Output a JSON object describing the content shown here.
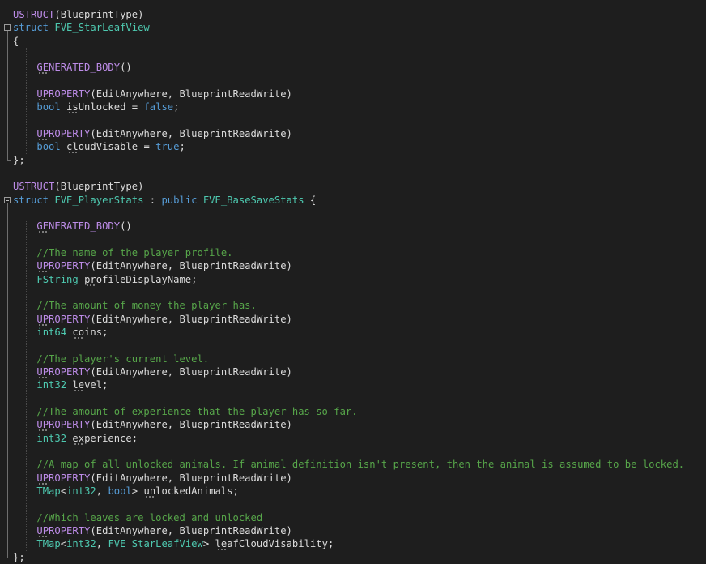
{
  "colors": {
    "background": "#1e1e1e",
    "default": "#dcdcdc",
    "keyword": "#569cd6",
    "macro": "#bd8ce8",
    "type": "#4ec9b0",
    "comment": "#57a64a",
    "variable": "#dcdcdc"
  },
  "lines": [
    {
      "tokens": [
        {
          "t": "USTRUCT",
          "c": "macro"
        },
        {
          "t": "(BlueprintType)",
          "c": "default"
        }
      ]
    },
    {
      "fold": true,
      "tokens": [
        {
          "t": "struct ",
          "c": "keyword"
        },
        {
          "t": "FVE_StarLeafView",
          "c": "type"
        }
      ]
    },
    {
      "tokens": [
        {
          "t": "{",
          "c": "default"
        }
      ]
    },
    {
      "tokens": []
    },
    {
      "tokens": [
        {
          "t": "    ",
          "c": "default"
        },
        {
          "t": "GENERATED_BODY",
          "c": "macro"
        },
        {
          "t": "()",
          "c": "default"
        }
      ]
    },
    {
      "tokens": []
    },
    {
      "tokens": [
        {
          "t": "    ",
          "c": "default"
        },
        {
          "t": "UPROPERTY",
          "c": "macro"
        },
        {
          "t": "(EditAnywhere, BlueprintReadWrite)",
          "c": "default"
        }
      ]
    },
    {
      "tokens": [
        {
          "t": "    ",
          "c": "default"
        },
        {
          "t": "bool ",
          "c": "keyword"
        },
        {
          "t": "isUnlocked",
          "c": "variable"
        },
        {
          "t": " = ",
          "c": "default"
        },
        {
          "t": "false",
          "c": "keyword"
        },
        {
          "t": ";",
          "c": "default"
        }
      ]
    },
    {
      "tokens": []
    },
    {
      "tokens": [
        {
          "t": "    ",
          "c": "default"
        },
        {
          "t": "UPROPERTY",
          "c": "macro"
        },
        {
          "t": "(EditAnywhere, BlueprintReadWrite)",
          "c": "default"
        }
      ]
    },
    {
      "tokens": [
        {
          "t": "    ",
          "c": "default"
        },
        {
          "t": "bool ",
          "c": "keyword"
        },
        {
          "t": "cloudVisable",
          "c": "variable"
        },
        {
          "t": " = ",
          "c": "default"
        },
        {
          "t": "true",
          "c": "keyword"
        },
        {
          "t": ";",
          "c": "default"
        }
      ]
    },
    {
      "tokens": [
        {
          "t": "};",
          "c": "default"
        }
      ]
    },
    {
      "tokens": []
    },
    {
      "tokens": [
        {
          "t": "USTRUCT",
          "c": "macro"
        },
        {
          "t": "(BlueprintType)",
          "c": "default"
        }
      ]
    },
    {
      "fold": true,
      "tokens": [
        {
          "t": "struct ",
          "c": "keyword"
        },
        {
          "t": "FVE_PlayerStats",
          "c": "type"
        },
        {
          "t": " : ",
          "c": "default"
        },
        {
          "t": "public ",
          "c": "keyword"
        },
        {
          "t": "FVE_BaseSaveStats",
          "c": "type"
        },
        {
          "t": " {",
          "c": "default"
        }
      ]
    },
    {
      "tokens": []
    },
    {
      "tokens": [
        {
          "t": "    ",
          "c": "default"
        },
        {
          "t": "GENERATED_BODY",
          "c": "macro"
        },
        {
          "t": "()",
          "c": "default"
        }
      ]
    },
    {
      "tokens": []
    },
    {
      "tokens": [
        {
          "t": "    ",
          "c": "default"
        },
        {
          "t": "//The name of the player profile.",
          "c": "comment"
        }
      ]
    },
    {
      "tokens": [
        {
          "t": "    ",
          "c": "default"
        },
        {
          "t": "UPROPERTY",
          "c": "macro"
        },
        {
          "t": "(EditAnywhere, BlueprintReadWrite)",
          "c": "default"
        }
      ]
    },
    {
      "tokens": [
        {
          "t": "    ",
          "c": "default"
        },
        {
          "t": "FString ",
          "c": "type"
        },
        {
          "t": "profileDisplayName",
          "c": "variable"
        },
        {
          "t": ";",
          "c": "default"
        }
      ]
    },
    {
      "tokens": []
    },
    {
      "tokens": [
        {
          "t": "    ",
          "c": "default"
        },
        {
          "t": "//The amount of money the player has.",
          "c": "comment"
        }
      ]
    },
    {
      "tokens": [
        {
          "t": "    ",
          "c": "default"
        },
        {
          "t": "UPROPERTY",
          "c": "macro"
        },
        {
          "t": "(EditAnywhere, BlueprintReadWrite)",
          "c": "default"
        }
      ]
    },
    {
      "tokens": [
        {
          "t": "    ",
          "c": "default"
        },
        {
          "t": "int64 ",
          "c": "type"
        },
        {
          "t": "coins",
          "c": "variable"
        },
        {
          "t": ";",
          "c": "default"
        }
      ]
    },
    {
      "tokens": []
    },
    {
      "tokens": [
        {
          "t": "    ",
          "c": "default"
        },
        {
          "t": "//The player's current level.",
          "c": "comment"
        }
      ]
    },
    {
      "tokens": [
        {
          "t": "    ",
          "c": "default"
        },
        {
          "t": "UPROPERTY",
          "c": "macro"
        },
        {
          "t": "(EditAnywhere, BlueprintReadWrite)",
          "c": "default"
        }
      ]
    },
    {
      "tokens": [
        {
          "t": "    ",
          "c": "default"
        },
        {
          "t": "int32 ",
          "c": "type"
        },
        {
          "t": "level",
          "c": "variable"
        },
        {
          "t": ";",
          "c": "default"
        }
      ]
    },
    {
      "tokens": []
    },
    {
      "tokens": [
        {
          "t": "    ",
          "c": "default"
        },
        {
          "t": "//The amount of experience that the player has so far.",
          "c": "comment"
        }
      ]
    },
    {
      "tokens": [
        {
          "t": "    ",
          "c": "default"
        },
        {
          "t": "UPROPERTY",
          "c": "macro"
        },
        {
          "t": "(EditAnywhere, BlueprintReadWrite)",
          "c": "default"
        }
      ]
    },
    {
      "tokens": [
        {
          "t": "    ",
          "c": "default"
        },
        {
          "t": "int32 ",
          "c": "type"
        },
        {
          "t": "experience",
          "c": "variable"
        },
        {
          "t": ";",
          "c": "default"
        }
      ]
    },
    {
      "tokens": []
    },
    {
      "tokens": [
        {
          "t": "    ",
          "c": "default"
        },
        {
          "t": "//A map of all unlocked animals. If animal definition isn't present, then the animal is assumed to be locked.",
          "c": "comment"
        }
      ]
    },
    {
      "tokens": [
        {
          "t": "    ",
          "c": "default"
        },
        {
          "t": "UPROPERTY",
          "c": "macro"
        },
        {
          "t": "(EditAnywhere, BlueprintReadWrite)",
          "c": "default"
        }
      ]
    },
    {
      "tokens": [
        {
          "t": "    ",
          "c": "default"
        },
        {
          "t": "TMap",
          "c": "type"
        },
        {
          "t": "<",
          "c": "default"
        },
        {
          "t": "int32",
          "c": "type"
        },
        {
          "t": ", ",
          "c": "default"
        },
        {
          "t": "bool",
          "c": "keyword"
        },
        {
          "t": "> ",
          "c": "default"
        },
        {
          "t": "unlockedAnimals",
          "c": "variable"
        },
        {
          "t": ";",
          "c": "default"
        }
      ]
    },
    {
      "tokens": []
    },
    {
      "tokens": [
        {
          "t": "    ",
          "c": "default"
        },
        {
          "t": "//Which leaves are locked and unlocked",
          "c": "comment"
        }
      ]
    },
    {
      "tokens": [
        {
          "t": "    ",
          "c": "default"
        },
        {
          "t": "UPROPERTY",
          "c": "macro"
        },
        {
          "t": "(EditAnywhere, BlueprintReadWrite)",
          "c": "default"
        }
      ]
    },
    {
      "tokens": [
        {
          "t": "    ",
          "c": "default"
        },
        {
          "t": "TMap",
          "c": "type"
        },
        {
          "t": "<",
          "c": "default"
        },
        {
          "t": "int32",
          "c": "type"
        },
        {
          "t": ", ",
          "c": "default"
        },
        {
          "t": "FVE_StarLeafView",
          "c": "type"
        },
        {
          "t": "> ",
          "c": "default"
        },
        {
          "t": "leafCloudVisability",
          "c": "variable"
        },
        {
          "t": ";",
          "c": "default"
        }
      ]
    },
    {
      "tokens": [
        {
          "t": "};",
          "c": "default"
        }
      ]
    }
  ]
}
